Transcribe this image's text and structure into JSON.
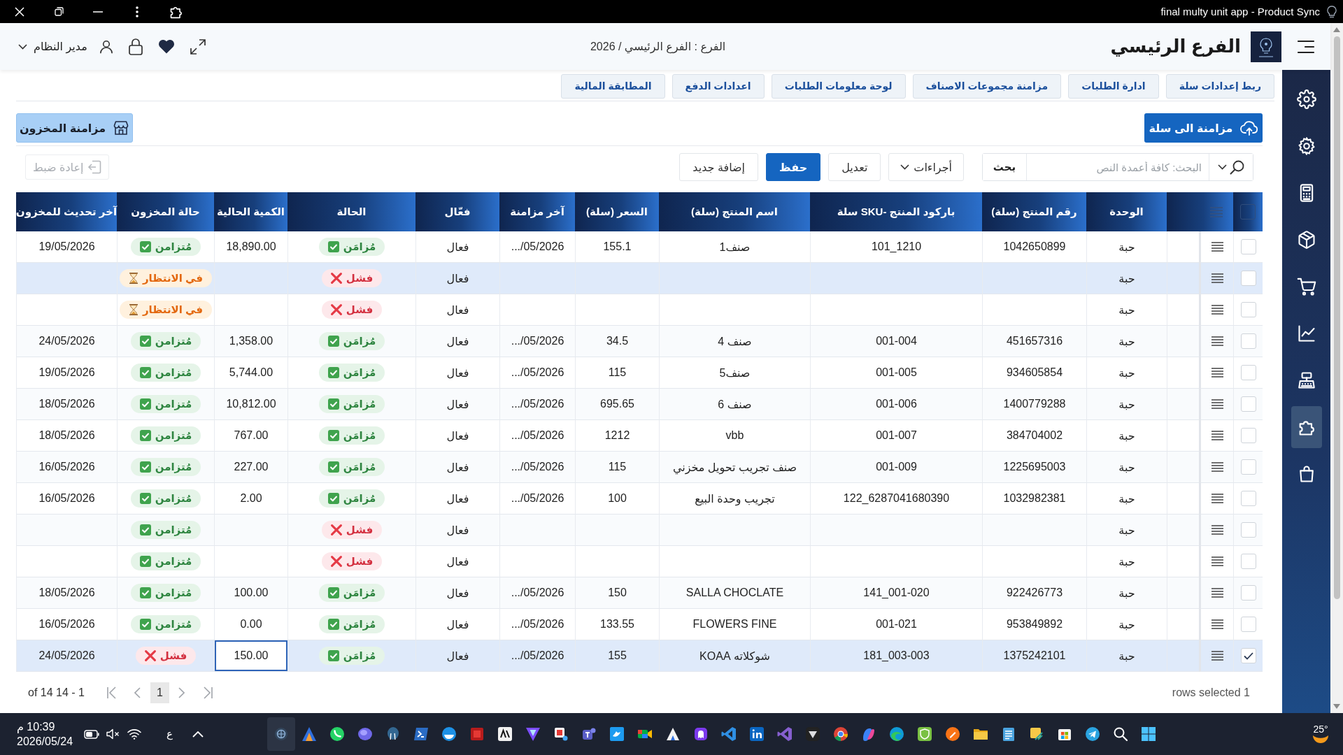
{
  "title_bar": {
    "title": "final multy unit app - Product Sync"
  },
  "header": {
    "branch_title": "الفرع الرئيسي",
    "context": "الفرع : الفرع الرئيسي / 2026",
    "user": "مدير النظام"
  },
  "sidebar": {
    "items": [
      {
        "selected": false
      },
      {
        "selected": false
      },
      {
        "selected": false
      },
      {
        "selected": false
      },
      {
        "selected": false
      },
      {
        "selected": false
      },
      {
        "selected": false
      },
      {
        "selected": true
      },
      {
        "selected": false
      }
    ]
  },
  "tabs": [
    {
      "label": "ربط إعدادات سلة",
      "selected": false
    },
    {
      "label": "ادارة الطلبات",
      "selected": false
    },
    {
      "label": "مزامنة مجموعات الاصناف",
      "selected": false
    },
    {
      "label": "لوحة معلومات الطلبات",
      "selected": false
    },
    {
      "label": "اعدادات الدفع",
      "selected": false
    },
    {
      "label": "المطابقة المالية",
      "selected": false
    }
  ],
  "sync": {
    "salla_button": "مزامنة الى سلة",
    "stock_button": "مزامنة المخزون"
  },
  "toolbar": {
    "search": {
      "placeholder": "البحث: كافة أعمدة النص",
      "button": "بحث"
    },
    "actions": "أجراءات",
    "buttons": [
      {
        "label": "تعديل",
        "kind": "default"
      },
      {
        "label": "حفظ",
        "kind": "primary"
      },
      {
        "label": "إضافة جديد",
        "kind": "default"
      }
    ],
    "reset": {
      "label": "إعادة ضبط",
      "disabled": true
    }
  },
  "table": {
    "select_all": {
      "checked": false
    },
    "columns": [
      "الوحدة",
      "رقم المنتج (سلة)",
      "باركود المنتج -SKU سلة",
      "اسم المنتج (سلة)",
      "السعر (سلة)",
      "آخر مزامنة",
      "فعّال",
      "الحالة",
      "الكمية الحالية",
      "حالة المخزون",
      "آخر تحديث للمخزون"
    ],
    "rows": [
      {
        "unit": "حبة",
        "product_no": "1042650899",
        "sku": "101_1210",
        "name": "صنف1",
        "price": "155.1",
        "last_sync": ".../05/2026",
        "active": "فعال",
        "status": {
          "label": "مُزامَن",
          "kind": "synced"
        },
        "qty": "18,890.00",
        "stock_status": {
          "label": "مُتزامن",
          "kind": "synced"
        },
        "stock_updated": "19/05/2026",
        "selected": false,
        "highlighted": false,
        "qty_editing": false
      },
      {
        "unit": "حبة",
        "active": "فعال",
        "status": {
          "label": "فشل",
          "kind": "failed"
        },
        "stock_status": {
          "label": "في الانتظار",
          "kind": "pending"
        },
        "selected": false,
        "highlighted": true,
        "qty_editing": false
      },
      {
        "unit": "حبة",
        "active": "فعال",
        "status": {
          "label": "فشل",
          "kind": "failed"
        },
        "stock_status": {
          "label": "في الانتظار",
          "kind": "pending"
        },
        "selected": false,
        "highlighted": false,
        "qty_editing": false
      },
      {
        "unit": "حبة",
        "product_no": "451657316",
        "sku": "001-004",
        "name": "صنف 4",
        "price": "34.5",
        "last_sync": ".../05/2026",
        "active": "فعال",
        "status": {
          "label": "مُزامَن",
          "kind": "synced"
        },
        "qty": "1,358.00",
        "stock_status": {
          "label": "مُتزامن",
          "kind": "synced"
        },
        "stock_updated": "24/05/2026",
        "selected": false,
        "highlighted": false,
        "qty_editing": false
      },
      {
        "unit": "حبة",
        "product_no": "934605854",
        "sku": "001-005",
        "name": "صنف5",
        "price": "115",
        "last_sync": ".../05/2026",
        "active": "فعال",
        "status": {
          "label": "مُزامَن",
          "kind": "synced"
        },
        "qty": "5,744.00",
        "stock_status": {
          "label": "مُتزامن",
          "kind": "synced"
        },
        "stock_updated": "19/05/2026",
        "selected": false,
        "highlighted": false,
        "qty_editing": false
      },
      {
        "unit": "حبة",
        "product_no": "1400779288",
        "sku": "001-006",
        "name": "صنف 6",
        "price": "695.65",
        "last_sync": ".../05/2026",
        "active": "فعال",
        "status": {
          "label": "مُزامَن",
          "kind": "synced"
        },
        "qty": "10,812.00",
        "stock_status": {
          "label": "مُتزامن",
          "kind": "synced"
        },
        "stock_updated": "18/05/2026",
        "selected": false,
        "highlighted": false,
        "qty_editing": false
      },
      {
        "unit": "حبة",
        "product_no": "384704002",
        "sku": "001-007",
        "name": "vbb",
        "price": "1212",
        "last_sync": ".../05/2026",
        "active": "فعال",
        "status": {
          "label": "مُزامَن",
          "kind": "synced"
        },
        "qty": "767.00",
        "stock_status": {
          "label": "مُتزامن",
          "kind": "synced"
        },
        "stock_updated": "18/05/2026",
        "selected": false,
        "highlighted": false,
        "qty_editing": false
      },
      {
        "unit": "حبة",
        "product_no": "1225695003",
        "sku": "001-009",
        "name": "صنف تجريب تحويل مخزني",
        "price": "115",
        "last_sync": ".../05/2026",
        "active": "فعال",
        "status": {
          "label": "مُزامَن",
          "kind": "synced"
        },
        "qty": "227.00",
        "stock_status": {
          "label": "مُتزامن",
          "kind": "synced"
        },
        "stock_updated": "16/05/2026",
        "selected": false,
        "highlighted": false,
        "qty_editing": false
      },
      {
        "unit": "حبة",
        "product_no": "1032982381",
        "sku": "122_6287041680390",
        "name": "تجريب وحدة البيع",
        "price": "100",
        "last_sync": ".../05/2026",
        "active": "فعال",
        "status": {
          "label": "مُزامَن",
          "kind": "synced"
        },
        "qty": "2.00",
        "stock_status": {
          "label": "مُتزامن",
          "kind": "synced"
        },
        "stock_updated": "16/05/2026",
        "selected": false,
        "highlighted": false,
        "qty_editing": false
      },
      {
        "unit": "حبة",
        "active": "فعال",
        "status": {
          "label": "فشل",
          "kind": "failed"
        },
        "stock_status": {
          "label": "مُتزامن",
          "kind": "synced"
        },
        "selected": false,
        "highlighted": false,
        "qty_editing": false
      },
      {
        "unit": "حبة",
        "active": "فعال",
        "status": {
          "label": "فشل",
          "kind": "failed"
        },
        "stock_status": {
          "label": "مُتزامن",
          "kind": "synced"
        },
        "selected": false,
        "highlighted": false,
        "qty_editing": false
      },
      {
        "unit": "حبة",
        "product_no": "922426773",
        "sku": "141_001-020",
        "name": "SALLA CHOCLATE",
        "price": "150",
        "last_sync": ".../05/2026",
        "active": "فعال",
        "status": {
          "label": "مُزامَن",
          "kind": "synced"
        },
        "qty": "100.00",
        "stock_status": {
          "label": "مُتزامن",
          "kind": "synced"
        },
        "stock_updated": "18/05/2026",
        "selected": false,
        "highlighted": false,
        "qty_editing": false
      },
      {
        "unit": "حبة",
        "product_no": "953849892",
        "sku": "001-021",
        "name": "FLOWERS FINE",
        "price": "133.55",
        "last_sync": ".../05/2026",
        "active": "فعال",
        "status": {
          "label": "مُزامَن",
          "kind": "synced"
        },
        "qty": "0.00",
        "stock_status": {
          "label": "مُتزامن",
          "kind": "synced"
        },
        "stock_updated": "16/05/2026",
        "selected": false,
        "highlighted": false,
        "qty_editing": false
      },
      {
        "unit": "حبة",
        "product_no": "1375242101",
        "sku": "181_003-003",
        "name": "شوكلاته KOAA",
        "price": "155",
        "last_sync": ".../05/2026",
        "active": "فعال",
        "status": {
          "label": "مُزامَن",
          "kind": "synced"
        },
        "qty": "150.00",
        "stock_status": {
          "label": "فشل",
          "kind": "failed"
        },
        "stock_updated": "24/05/2026",
        "selected": true,
        "highlighted": false,
        "qty_editing": true
      }
    ]
  },
  "footer": {
    "range": "of 14 14 - 1",
    "pages": [
      {
        "label": "1",
        "selected": true
      }
    ],
    "selection": "rows selected 1"
  },
  "taskbar": {
    "time": "10:39 م",
    "date": "2026/05/24",
    "language": "ع",
    "temperature": "25°"
  }
}
